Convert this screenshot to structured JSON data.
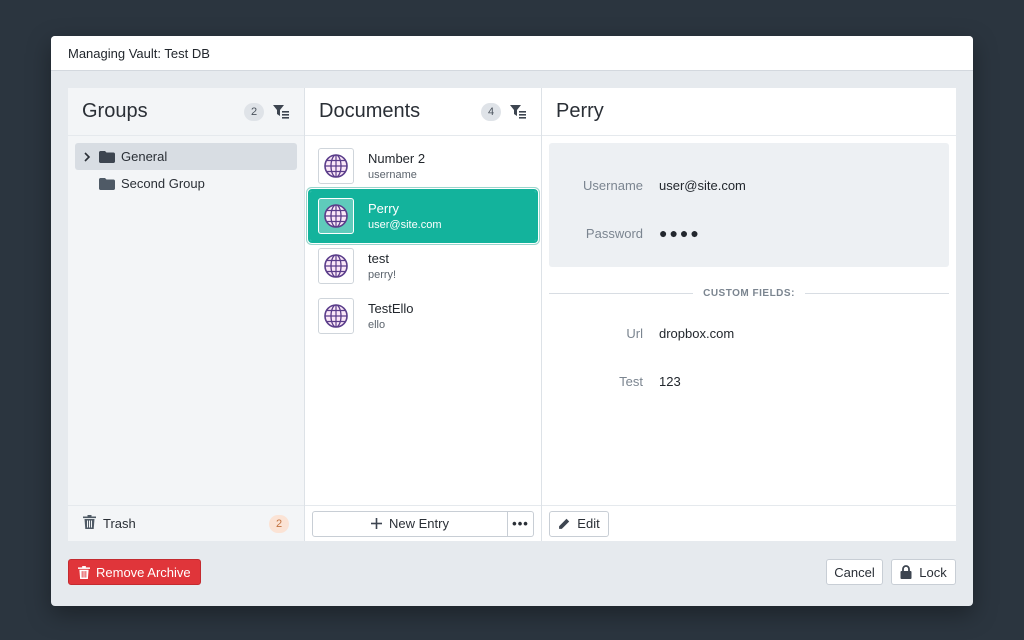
{
  "window": {
    "title": "Managing Vault: Test DB"
  },
  "groups": {
    "title": "Groups",
    "count": "2",
    "items": [
      {
        "label": "General",
        "expandable": true,
        "selected": true
      },
      {
        "label": "Second Group",
        "expandable": false,
        "selected": false
      }
    ],
    "trash_label": "Trash",
    "trash_count": "2"
  },
  "documents": {
    "title": "Documents",
    "count": "4",
    "items": [
      {
        "title": "Number 2",
        "subtitle": "username",
        "icon": "globe-icon",
        "selected": false
      },
      {
        "title": "Perry",
        "subtitle": "user@site.com",
        "icon": "globe-icon",
        "selected": true
      },
      {
        "title": "test",
        "subtitle": "perry!",
        "icon": "globe-icon",
        "selected": false
      },
      {
        "title": "TestEllo",
        "subtitle": "ello",
        "icon": "globe-icon",
        "selected": false
      }
    ],
    "new_entry_label": "New Entry",
    "more_label": "•••"
  },
  "detail": {
    "title": "Perry",
    "fields": [
      {
        "label": "Username",
        "value": "user@site.com"
      },
      {
        "label": "Password",
        "value": "●●●●"
      }
    ],
    "custom_fields_label": "CUSTOM FIELDS:",
    "custom_fields": [
      {
        "label": "Url",
        "value": "dropbox.com"
      },
      {
        "label": "Test",
        "value": "123"
      }
    ],
    "edit_label": "Edit"
  },
  "footer": {
    "remove_label": "Remove Archive",
    "cancel_label": "Cancel",
    "lock_label": "Lock"
  },
  "colors": {
    "accent": "#13b39c",
    "danger": "#e0353a",
    "background": "#2b353f"
  }
}
